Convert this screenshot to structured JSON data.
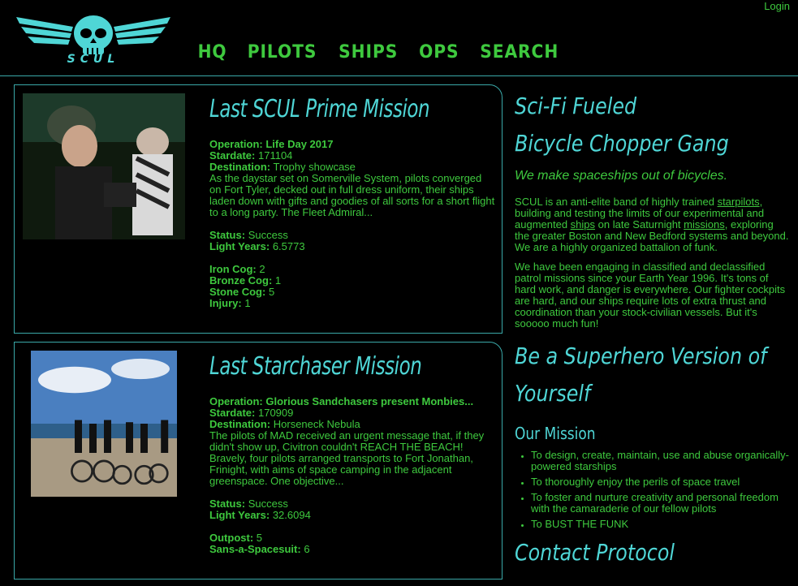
{
  "header": {
    "login": "Login",
    "nav": [
      "HQ",
      "PILOTS",
      "SHIPS",
      "OPS",
      "SEARCH"
    ],
    "logo_text": "SCUL"
  },
  "missions": [
    {
      "title": "Last SCUL Prime Mission",
      "operation_label": "Operation:",
      "operation": "Life Day 2017",
      "stardate_label": "Stardate:",
      "stardate": "171104",
      "destination_label": "Destination:",
      "destination": "Trophy showcase",
      "description": "As the daystar set on Somerville System, pilots converged on Fort Tyler, decked out in full dress uniform, their ships laden down with gifts and goodies of all sorts for a short flight to a long party. The Fleet Admiral...",
      "status_label": "Status:",
      "status": "Success",
      "lightyears_label": "Light Years:",
      "lightyears": "6.5773",
      "extras": [
        {
          "label": "Iron Cog:",
          "value": "2"
        },
        {
          "label": "Bronze Cog:",
          "value": "1"
        },
        {
          "label": "Stone Cog:",
          "value": "5"
        },
        {
          "label": "Injury:",
          "value": "1"
        }
      ]
    },
    {
      "title": "Last Starchaser Mission",
      "operation_label": "Operation:",
      "operation": "Glorious Sandchasers present Monbies...",
      "stardate_label": "Stardate:",
      "stardate": "170909",
      "destination_label": "Destination:",
      "destination": "Horseneck Nebula",
      "description": "The pilots of MAD received an urgent message that, if they didn't show up, Civitron couldn't REACH THE BEACH! Bravely, four pilots arranged transports to Fort Jonathan, Frinight, with aims of space camping in the adjacent greenspace. One objective...",
      "status_label": "Status:",
      "status": "Success",
      "lightyears_label": "Light Years:",
      "lightyears": "32.6094",
      "extras": [
        {
          "label": "Outpost:",
          "value": "5"
        },
        {
          "label": "Sans-a-Spacesuit:",
          "value": "6"
        }
      ]
    }
  ],
  "sidebar": {
    "headline1": "Sci-Fi Fueled",
    "headline2": "Bicycle Chopper Gang",
    "tagline": "We make spaceships out of bicycles.",
    "para1_a": "SCUL is an anti-elite band of highly trained ",
    "para1_link1": "starpilots",
    "para1_b": ", building and testing the limits of our experimental and augmented ",
    "para1_link2": "ships",
    "para1_c": " on late Saturnight ",
    "para1_link3": "missions",
    "para1_d": ", exploring the greater Boston and New Bedford systems and beyond. We are a highly organized battalion of funk.",
    "para2": "We have been engaging in classified and declassified patrol missions since your Earth Year 1996. It's tons of hard work, and danger is everywhere. Our fighter cockpits are hard, and our ships require lots of extra thrust and coordination than your stock-civilian vessels. But it's sooooo much fun!",
    "headline3a": "Be a Superhero Version of",
    "headline3b": "Yourself",
    "mission_title": "Our Mission",
    "mission_items": [
      "To design, create, maintain, use and abuse organically-powered starships",
      "To thoroughly enjoy the perils of space travel",
      "To foster and nurture creativity and personal freedom with the camaraderie of our fellow pilots",
      "To BUST THE FUNK"
    ],
    "headline4": "Contact Protocol"
  },
  "colors": {
    "accent_green": "#3ec93e",
    "accent_cyan": "#4fd6d6",
    "border": "#3aa8a8"
  }
}
